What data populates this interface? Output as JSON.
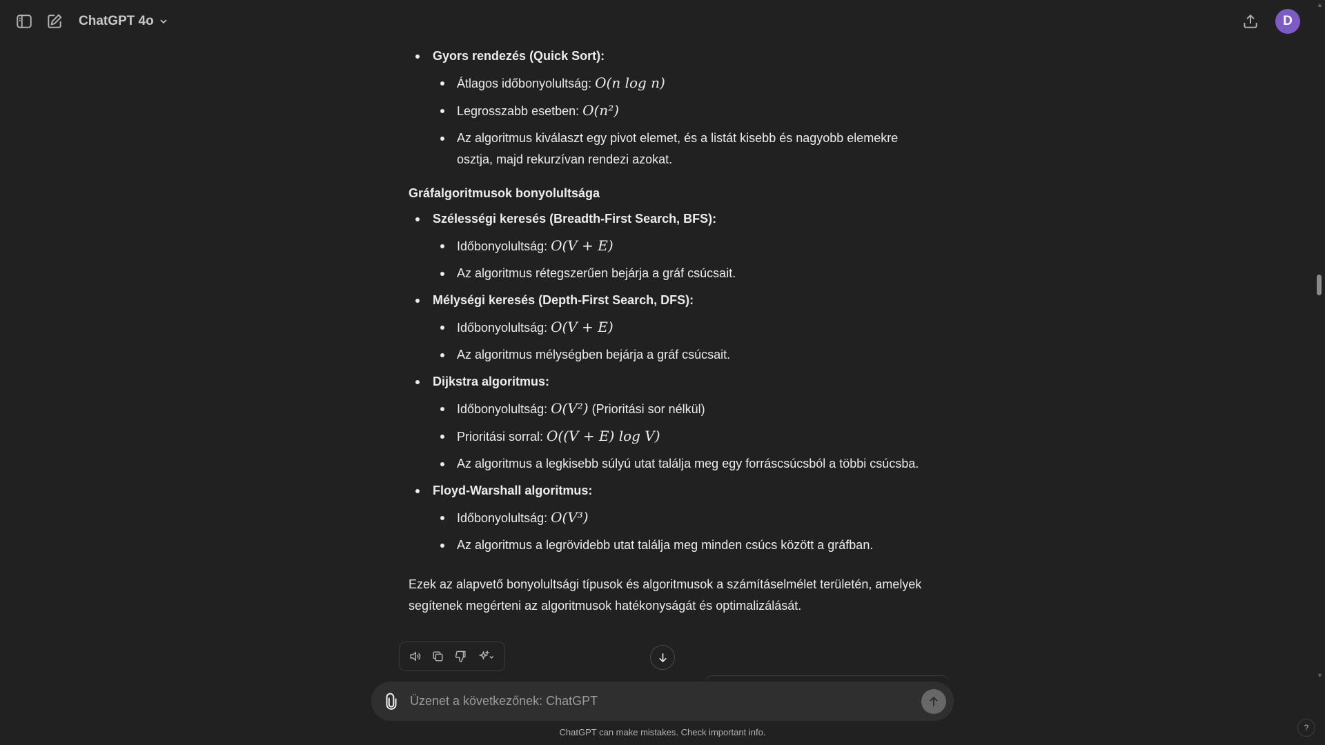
{
  "header": {
    "model_label": "ChatGPT 4o",
    "avatar_initial": "D"
  },
  "message": {
    "sort_item": {
      "title": "Gyors rendezés (Quick Sort):",
      "avg_prefix": "Átlagos időbonyolultság: ",
      "avg_math": "O(n log n)",
      "worst_prefix": "Legrosszabb esetben: ",
      "worst_math": "O(n²)",
      "desc": "Az algoritmus kiválaszt egy pivot elemet, és a listát kisebb és nagyobb elemekre osztja, majd rekurzívan rendezi azokat."
    },
    "graph_heading": "Gráfalgoritmusok bonyolultsága",
    "bfs": {
      "title": "Szélességi keresés (Breadth-First Search, BFS):",
      "time_prefix": "Időbonyolultság: ",
      "time_math": "O(V + E)",
      "desc": "Az algoritmus rétegszerűen bejárja a gráf csúcsait."
    },
    "dfs": {
      "title": "Mélységi keresés (Depth-First Search, DFS):",
      "time_prefix": "Időbonyolultság: ",
      "time_math": "O(V + E)",
      "desc": "Az algoritmus mélységben bejárja a gráf csúcsait."
    },
    "dijkstra": {
      "title": "Dijkstra algoritmus:",
      "time_prefix": "Időbonyolultság: ",
      "time_math": "O(V²)",
      "time_suffix": " (Prioritási sor nélkül)",
      "pq_prefix": "Prioritási sorral: ",
      "pq_math": "O((V + E) log V)",
      "desc": "Az algoritmus a legkisebb súlyú utat találja meg egy forráscsúcsból a többi csúcsba."
    },
    "floyd": {
      "title": "Floyd-Warshall algoritmus:",
      "time_prefix": "Időbonyolultság: ",
      "time_math": "O(V³)",
      "desc": "Az algoritmus a legrövidebb utat találja meg minden csúcs között a gráfban."
    },
    "closing": "Ezek az alapvető bonyolultsági típusok és algoritmusok a számításelmélet területén, amelyek segítenek megérteni az algoritmusok hatékonyságát és optimalizálását."
  },
  "composer": {
    "placeholder": "Üzenet a következőnek: ChatGPT"
  },
  "footer": {
    "disclaimer": "ChatGPT can make mistakes. Check important info.",
    "help": "?"
  }
}
